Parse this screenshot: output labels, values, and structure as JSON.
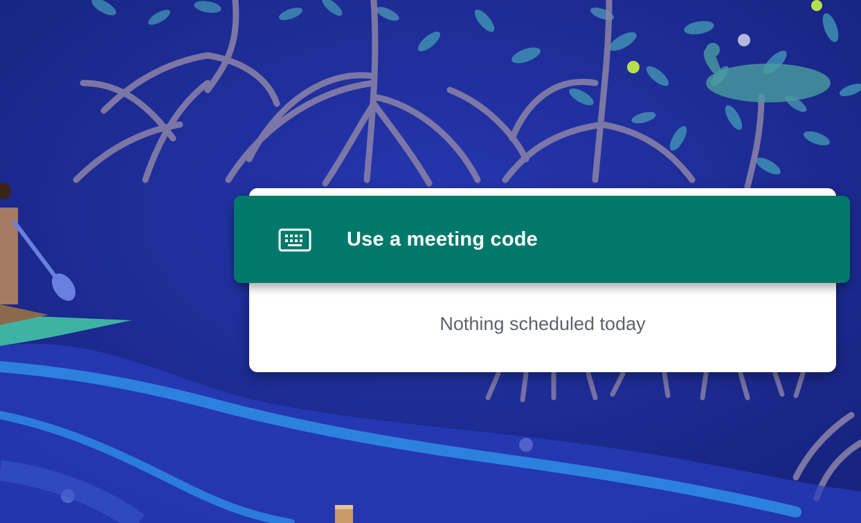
{
  "meeting_code_button": {
    "label": "Use a meeting code",
    "icon": "keyboard-icon"
  },
  "schedule": {
    "empty_text": "Nothing scheduled today"
  },
  "colors": {
    "background_navy": "#1f2f9e",
    "accent_teal": "#00796b",
    "card_white": "#ffffff",
    "muted_text": "#5f6368"
  }
}
